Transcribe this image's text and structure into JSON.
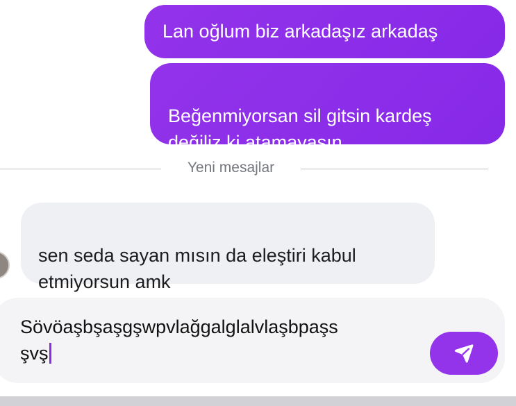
{
  "conversation": {
    "outgoing": [
      {
        "text": "Lan oğlum biz arkadaşız arkadaş"
      },
      {
        "text": "Beğenmiyorsan sil gitsin kardeş\ndeğiliz ki atamayasın"
      }
    ],
    "new_messages_label": "Yeni mesajlar",
    "incoming": [
      {
        "text": "sen seda sayan mısın da eleştiri kabul\netmiyorsun amk"
      }
    ]
  },
  "composer": {
    "value": "Sövöaşbşaşgşwpvlağgalglalvlaşbpaşs\nşvş",
    "send_icon": "send-icon"
  },
  "colors": {
    "accent": "#9333ea",
    "incoming_bubble": "#eff0f4",
    "composer_bg": "#f4f4f6"
  }
}
